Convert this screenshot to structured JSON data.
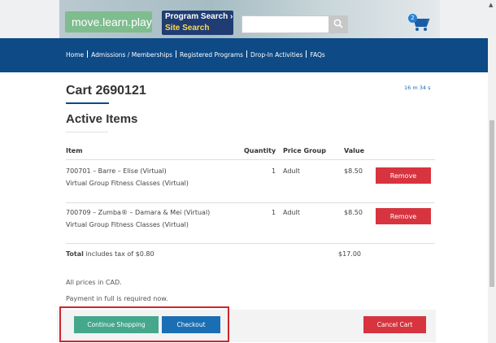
{
  "header": {
    "logo_text": "move.learn.play",
    "program_search_label": "Program Search ›",
    "site_search_label": "Site Search",
    "search_placeholder": "",
    "cart_count": "2"
  },
  "nav": {
    "items": [
      {
        "label": "Home"
      },
      {
        "label": "Admissions / Memberships"
      },
      {
        "label": "Registered Programs"
      },
      {
        "label": "Drop-In Activities"
      },
      {
        "label": "FAQs"
      }
    ]
  },
  "cart": {
    "title": "Cart 2690121",
    "timer": "16 m 34 s",
    "section_title": "Active Items",
    "columns": {
      "item": "Item",
      "quantity": "Quantity",
      "price_group": "Price Group",
      "value": "Value"
    },
    "rows": [
      {
        "line1": "700701 – Barre – Elise (Virtual)",
        "line2": "Virtual Group Fitness Classes (Virtual)",
        "quantity": "1",
        "price_group": "Adult",
        "value": "$8.50",
        "remove_label": "Remove"
      },
      {
        "line1": "700709 – Zumba® – Damara & Mei (Virtual)",
        "line2": "Virtual Group Fitness Classes (Virtual)",
        "quantity": "1",
        "price_group": "Adult",
        "value": "$8.50",
        "remove_label": "Remove"
      }
    ],
    "total_label": "Total",
    "total_tax_text": " includes tax of $0.80",
    "total_value": "$17.00",
    "note_currency": "All prices in CAD.",
    "note_payment": "Payment in full is required now."
  },
  "actions": {
    "continue_label": "Continue Shopping",
    "checkout_label": "Checkout",
    "cancel_label": "Cancel Cart"
  },
  "colors": {
    "nav_bg": "#0d4a86",
    "remove_red": "#d7343f",
    "continue_green": "#45a78c",
    "checkout_blue": "#1a6fb4",
    "highlight_red": "#d0262e"
  }
}
